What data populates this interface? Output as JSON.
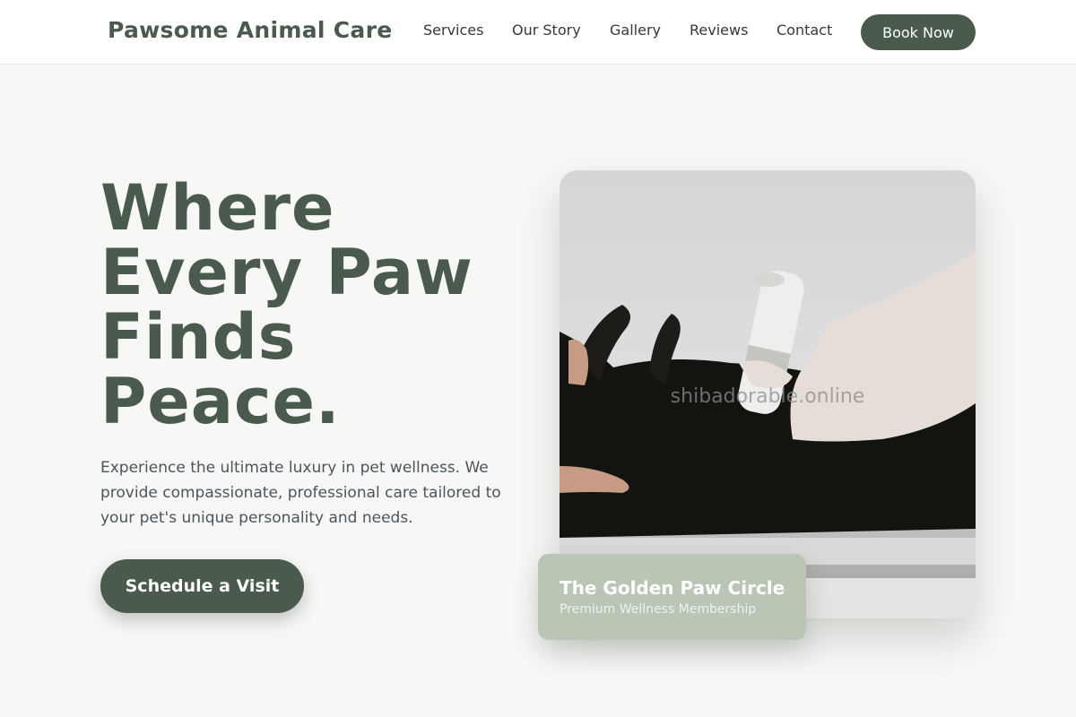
{
  "header": {
    "brand": "Pawsome Animal Care",
    "nav": [
      "Services",
      "Our Story",
      "Gallery",
      "Reviews",
      "Contact"
    ],
    "book_label": "Book Now"
  },
  "hero": {
    "title_lines": [
      "Where",
      "Every Paw",
      "Finds",
      "Peace."
    ],
    "description": "Experience the ultimate luxury in pet wellness. We provide compassionate, professional care tailored to your pet's unique personality and needs.",
    "cta_label": "Schedule a Visit"
  },
  "photo": {
    "watermark": "shibadorable.online"
  },
  "membership": {
    "title": "The Golden Paw Circle",
    "subtitle": "Premium Wellness Membership"
  },
  "colors": {
    "accent": "#4a5a4c",
    "background": "#f7f7f5",
    "badge": "#b9c6b5"
  }
}
